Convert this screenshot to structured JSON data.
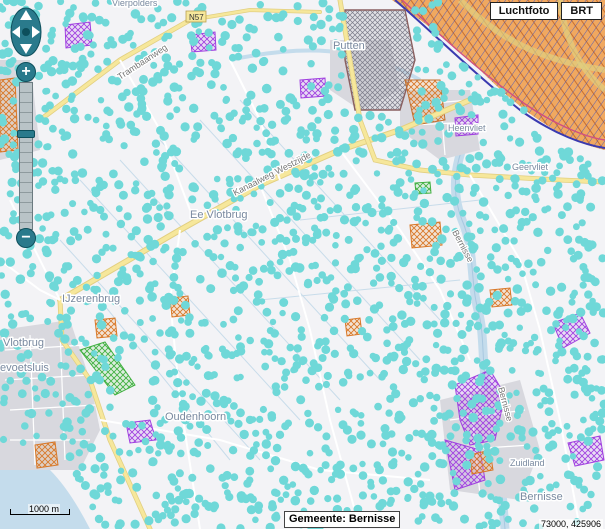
{
  "layers": {
    "aerial_label": "Luchtfoto",
    "topo_label": "BRT"
  },
  "places": {
    "vlotbrug_east": "Ee Vlotbrug",
    "putten": "Putten",
    "ijzerenbrug": "IJzerenbrug",
    "vlotbrug_west": "Vlotbrug",
    "voetsluis": "evoetsluis",
    "oudenhoorn": "Oudenhoorn",
    "bernisse": "Bernisse",
    "zuidland": "Zuidland",
    "heenvliet": "Heenvliet",
    "geervliet": "Geervliet",
    "vierpolders": "Vierpolders"
  },
  "roads": {
    "kanaalweg": "Kanaalweg Westzijde",
    "trambaanweg": "Trambaanweg",
    "bernisse_road": "Bernisse",
    "n57": "N57"
  },
  "scale": {
    "label": "1000 m"
  },
  "municipality": {
    "label": "Gemeente: Bernisse"
  },
  "coordinates": {
    "text": "73000, 425906"
  },
  "colors": {
    "tree_dot": "#6fd8d8",
    "hatch_purple": "#a040e0",
    "hatch_orange": "#e08030",
    "hatch_green": "#40b840",
    "water": "#c4dcec",
    "road_main": "#f6e79b",
    "road_minor": "#ffffff",
    "nav_teal": "#2a7a8c"
  },
  "icons": {
    "pan": "pan-arrows-icon",
    "zoom_in": "plus-icon",
    "zoom_out": "minus-icon"
  }
}
